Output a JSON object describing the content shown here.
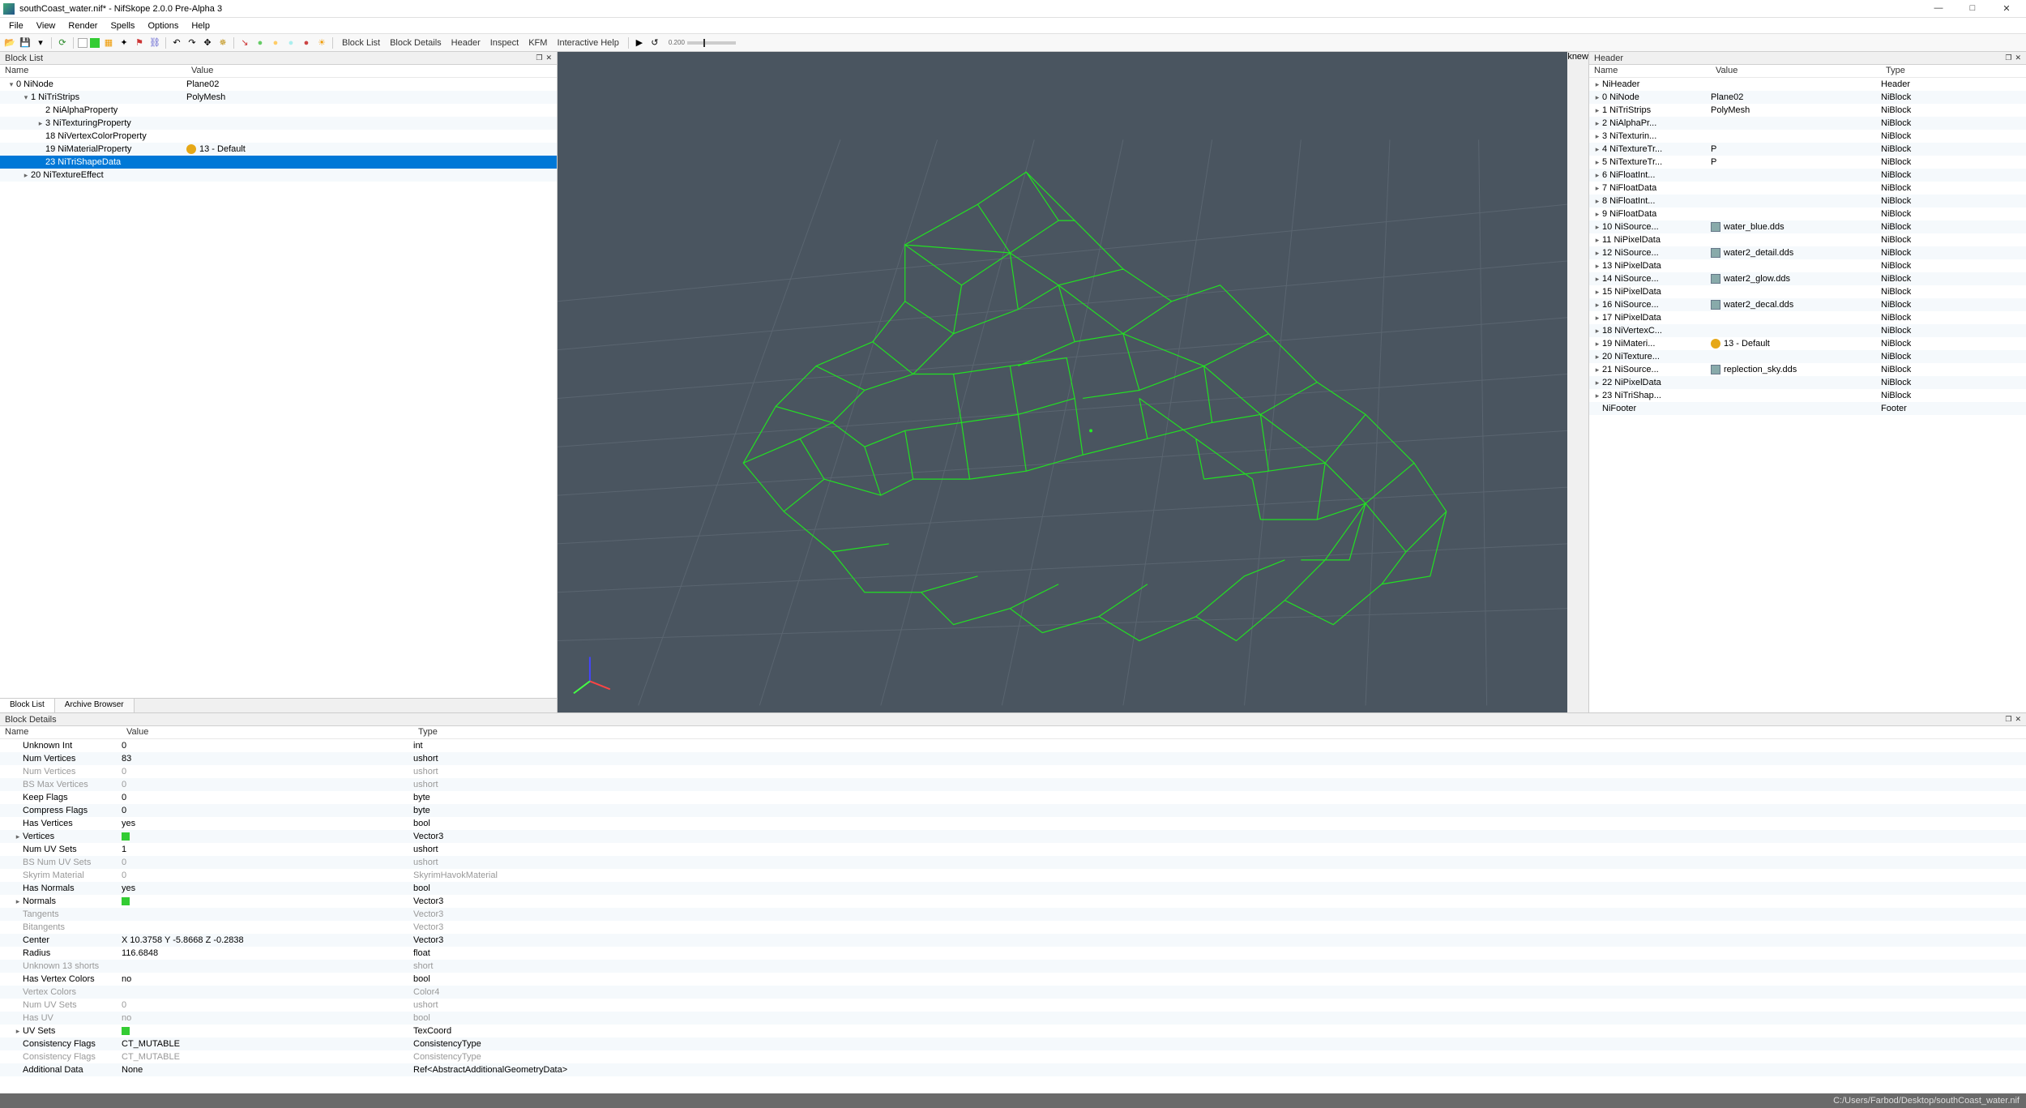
{
  "window": {
    "title": "southCoast_water.nif* - NifSkope 2.0.0 Pre-Alpha 3",
    "min": "—",
    "max": "□",
    "close": "✕"
  },
  "menubar": [
    "File",
    "View",
    "Render",
    "Spells",
    "Options",
    "Help"
  ],
  "toolbar_text": [
    "Block List",
    "Block Details",
    "Header",
    "Inspect",
    "KFM",
    "Interactive Help"
  ],
  "slider_label": "0.200",
  "left_panel": {
    "title": "Block List",
    "cols": {
      "name": "Name",
      "value": "Value"
    },
    "rows": [
      {
        "indent": 0,
        "exp": "▾",
        "name": "0 NiNode",
        "value": "Plane02",
        "sel": false
      },
      {
        "indent": 1,
        "exp": "▾",
        "name": "1 NiTriStrips",
        "value": "PolyMesh",
        "sel": false
      },
      {
        "indent": 2,
        "exp": "",
        "name": "2 NiAlphaProperty",
        "value": "",
        "sel": false
      },
      {
        "indent": 2,
        "exp": "▸",
        "name": "3 NiTexturingProperty",
        "value": "",
        "sel": false
      },
      {
        "indent": 2,
        "exp": "",
        "name": "18 NiVertexColorProperty",
        "value": "",
        "sel": false
      },
      {
        "indent": 2,
        "exp": "",
        "name": "19 NiMaterialProperty",
        "value": "13 - Default",
        "icon": "mat",
        "sel": false
      },
      {
        "indent": 2,
        "exp": "",
        "name": "23 NiTriShapeData",
        "value": "",
        "sel": true
      },
      {
        "indent": 1,
        "exp": "▸",
        "name": "20 NiTextureEffect",
        "value": "",
        "sel": false
      }
    ],
    "tabs": [
      "Block List",
      "Archive Browser"
    ],
    "active_tab": 0
  },
  "right_panel": {
    "title": "Header",
    "cols": {
      "name": "Name",
      "value": "Value",
      "type": "Type"
    },
    "rows": [
      {
        "exp": "▸",
        "name": "NiHeader",
        "value": "",
        "type": "Header"
      },
      {
        "exp": "▸",
        "name": "0 NiNode",
        "value": "Plane02",
        "type": "NiBlock"
      },
      {
        "exp": "▸",
        "name": "1 NiTriStrips",
        "value": "PolyMesh",
        "type": "NiBlock"
      },
      {
        "exp": "▸",
        "name": "2 NiAlphaPr...",
        "value": "",
        "type": "NiBlock"
      },
      {
        "exp": "▸",
        "name": "3 NiTexturin...",
        "value": "",
        "type": "NiBlock"
      },
      {
        "exp": "▸",
        "name": "4 NiTextureTr...",
        "value": "P",
        "type": "NiBlock"
      },
      {
        "exp": "▸",
        "name": "5 NiTextureTr...",
        "value": "P",
        "type": "NiBlock"
      },
      {
        "exp": "▸",
        "name": "6 NiFloatInt...",
        "value": "",
        "type": "NiBlock"
      },
      {
        "exp": "▸",
        "name": "7 NiFloatData",
        "value": "",
        "type": "NiBlock"
      },
      {
        "exp": "▸",
        "name": "8 NiFloatInt...",
        "value": "",
        "type": "NiBlock"
      },
      {
        "exp": "▸",
        "name": "9 NiFloatData",
        "value": "",
        "type": "NiBlock"
      },
      {
        "exp": "▸",
        "name": "10 NiSource...",
        "value": "water_blue.dds",
        "icon": "tex",
        "type": "NiBlock"
      },
      {
        "exp": "▸",
        "name": "11 NiPixelData",
        "value": "",
        "type": "NiBlock"
      },
      {
        "exp": "▸",
        "name": "12 NiSource...",
        "value": "water2_detail.dds",
        "icon": "tex",
        "type": "NiBlock"
      },
      {
        "exp": "▸",
        "name": "13 NiPixelData",
        "value": "",
        "type": "NiBlock"
      },
      {
        "exp": "▸",
        "name": "14 NiSource...",
        "value": "water2_glow.dds",
        "icon": "tex",
        "type": "NiBlock"
      },
      {
        "exp": "▸",
        "name": "15 NiPixelData",
        "value": "",
        "type": "NiBlock"
      },
      {
        "exp": "▸",
        "name": "16 NiSource...",
        "value": "water2_decal.dds",
        "icon": "tex",
        "type": "NiBlock"
      },
      {
        "exp": "▸",
        "name": "17 NiPixelData",
        "value": "",
        "type": "NiBlock"
      },
      {
        "exp": "▸",
        "name": "18 NiVertexC...",
        "value": "",
        "type": "NiBlock"
      },
      {
        "exp": "▸",
        "name": "19 NiMateri...",
        "value": "13 - Default",
        "icon": "mat",
        "type": "NiBlock"
      },
      {
        "exp": "▸",
        "name": "20 NiTexture...",
        "value": "",
        "type": "NiBlock"
      },
      {
        "exp": "▸",
        "name": "21 NiSource...",
        "value": "replection_sky.dds",
        "icon": "tex",
        "type": "NiBlock"
      },
      {
        "exp": "▸",
        "name": "22 NiPixelData",
        "value": "",
        "type": "NiBlock"
      },
      {
        "exp": "▸",
        "name": "23 NiTriShap...",
        "value": "",
        "type": "NiBlock"
      },
      {
        "exp": "",
        "name": "NiFooter",
        "value": "",
        "type": "Footer"
      }
    ]
  },
  "block_details": {
    "title": "Block Details",
    "cols": {
      "name": "Name",
      "value": "Value",
      "type": "Type"
    },
    "rows": [
      {
        "dim": false,
        "exp": "",
        "name": "Unknown Int",
        "value": "0",
        "type": "int"
      },
      {
        "dim": false,
        "exp": "",
        "name": "Num Vertices",
        "value": "83",
        "type": "ushort"
      },
      {
        "dim": true,
        "exp": "",
        "name": "Num Vertices",
        "value": "0",
        "type": "ushort"
      },
      {
        "dim": true,
        "exp": "",
        "name": "BS Max Vertices",
        "value": "0",
        "type": "ushort"
      },
      {
        "dim": false,
        "exp": "",
        "name": "Keep Flags",
        "value": "0",
        "type": "byte"
      },
      {
        "dim": false,
        "exp": "",
        "name": "Compress Flags",
        "value": "0",
        "type": "byte"
      },
      {
        "dim": false,
        "exp": "",
        "name": "Has Vertices",
        "value": "yes",
        "type": "bool"
      },
      {
        "dim": false,
        "exp": "▸",
        "name": "Vertices",
        "value": "",
        "icon": "arr",
        "type": "Vector3"
      },
      {
        "dim": false,
        "exp": "",
        "name": "Num UV Sets",
        "value": "1",
        "type": "ushort"
      },
      {
        "dim": true,
        "exp": "",
        "name": "BS Num UV Sets",
        "value": "0",
        "type": "ushort"
      },
      {
        "dim": true,
        "exp": "",
        "name": "Skyrim Material",
        "value": "0",
        "type": "SkyrimHavokMaterial"
      },
      {
        "dim": false,
        "exp": "",
        "name": "Has Normals",
        "value": "yes",
        "type": "bool"
      },
      {
        "dim": false,
        "exp": "▸",
        "name": "Normals",
        "value": "",
        "icon": "arr",
        "type": "Vector3"
      },
      {
        "dim": true,
        "exp": "",
        "name": "Tangents",
        "value": "",
        "type": "Vector3"
      },
      {
        "dim": true,
        "exp": "",
        "name": "Bitangents",
        "value": "",
        "type": "Vector3"
      },
      {
        "dim": false,
        "exp": "",
        "name": "Center",
        "value": "X 10.3758 Y -5.8668 Z -0.2838",
        "type": "Vector3"
      },
      {
        "dim": false,
        "exp": "",
        "name": "Radius",
        "value": "116.6848",
        "type": "float"
      },
      {
        "dim": true,
        "exp": "",
        "name": "Unknown 13 shorts",
        "value": "",
        "type": "short"
      },
      {
        "dim": false,
        "exp": "",
        "name": "Has Vertex Colors",
        "value": "no",
        "type": "bool"
      },
      {
        "dim": true,
        "exp": "",
        "name": "Vertex Colors",
        "value": "",
        "type": "Color4"
      },
      {
        "dim": true,
        "exp": "",
        "name": "Num UV Sets",
        "value": "0",
        "type": "ushort"
      },
      {
        "dim": true,
        "exp": "",
        "name": "Has UV",
        "value": "no",
        "type": "bool"
      },
      {
        "dim": false,
        "exp": "▸",
        "name": "UV Sets",
        "value": "",
        "icon": "arr",
        "type": "TexCoord"
      },
      {
        "dim": false,
        "exp": "",
        "name": "Consistency Flags",
        "value": "CT_MUTABLE",
        "type": "ConsistencyType"
      },
      {
        "dim": true,
        "exp": "",
        "name": "Consistency Flags",
        "value": "CT_MUTABLE",
        "type": "ConsistencyType"
      },
      {
        "dim": false,
        "exp": "",
        "name": "Additional Data",
        "value": "None",
        "type": "Ref<AbstractAdditionalGeometryData>"
      }
    ]
  },
  "statusbar": {
    "path": "C:/Users/Farbod/Desktop/southCoast_water.nif"
  }
}
